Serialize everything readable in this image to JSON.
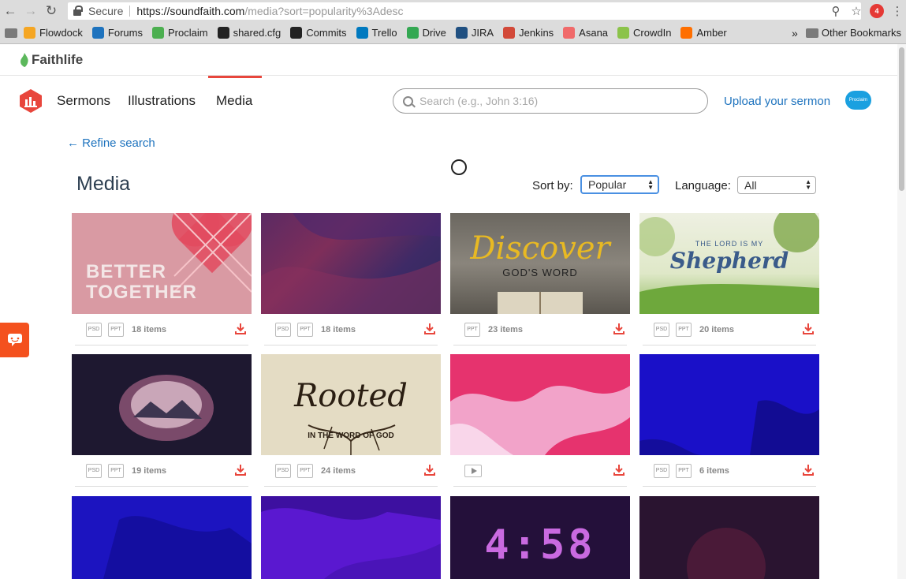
{
  "browser": {
    "secure_label": "Secure",
    "url_host": "https://soundfaith.com",
    "url_path": "/media?sort=popularity%3Adesc",
    "extension_badge": "4",
    "bookmarks": [
      {
        "label": "Flowdock",
        "color": "#f5a623"
      },
      {
        "label": "Forums",
        "color": "#1e73be"
      },
      {
        "label": "Proclaim",
        "color": "#4caf50"
      },
      {
        "label": "shared.cfg",
        "color": "#222222"
      },
      {
        "label": "Commits",
        "color": "#222222"
      },
      {
        "label": "Trello",
        "color": "#0079bf"
      },
      {
        "label": "Drive",
        "color": "#34a853"
      },
      {
        "label": "JIRA",
        "color": "#205081"
      },
      {
        "label": "Jenkins",
        "color": "#d24939"
      },
      {
        "label": "Asana",
        "color": "#f06a6a"
      },
      {
        "label": "CrowdIn",
        "color": "#8bc34a"
      },
      {
        "label": "Amber",
        "color": "#ff6f00"
      }
    ],
    "more_bookmarks": "»",
    "other_bookmarks": "Other Bookmarks"
  },
  "faithlife": {
    "logo": "Faithlife"
  },
  "nav": {
    "items": [
      "Sermons",
      "Illustrations",
      "Media"
    ],
    "active": "Media",
    "search_placeholder": "Search (e.g., John 3:16)",
    "upload": "Upload your sermon",
    "avatar": "Proclaim"
  },
  "refine": "← Refine search",
  "page": {
    "title": "Media",
    "sort_label": "Sort by:",
    "sort_value": "Popular",
    "language_label": "Language:",
    "language_value": "All"
  },
  "cards": [
    {
      "title": "BETTER TOGETHER",
      "files": [
        "PSD",
        "PPT"
      ],
      "count": "18 items"
    },
    {
      "title": "",
      "files": [
        "PSD",
        "PPT"
      ],
      "count": "18 items"
    },
    {
      "title": "Discover GOD'S WORD",
      "files": [
        "PPT"
      ],
      "count": "23 items"
    },
    {
      "title": "THE LORD IS MY Shepherd",
      "files": [
        "PSD",
        "PPT"
      ],
      "count": "20 items"
    },
    {
      "title": "",
      "files": [
        "PSD",
        "PPT"
      ],
      "count": "19 items"
    },
    {
      "title": "Rooted IN THE WORD OF GOD",
      "files": [
        "PSD",
        "PPT"
      ],
      "count": "24 items"
    },
    {
      "title": "",
      "files": [
        "video"
      ],
      "count": ""
    },
    {
      "title": "",
      "files": [
        "PSD",
        "PPT"
      ],
      "count": "6 items"
    },
    {
      "title": "",
      "files": [],
      "count": ""
    },
    {
      "title": "",
      "files": [],
      "count": ""
    },
    {
      "title": "4:58",
      "files": [],
      "count": ""
    },
    {
      "title": "",
      "files": [],
      "count": ""
    }
  ],
  "thumb_text": {
    "better": "BETTER",
    "together": "TOGETHER",
    "discover": "Discover",
    "gods_word": "GOD'S WORD",
    "lord_is_my": "THE LORD IS MY",
    "shepherd": "Shepherd",
    "rooted": "Rooted",
    "in_the_word": "IN THE WORD OF GOD",
    "countdown": "4:58"
  }
}
